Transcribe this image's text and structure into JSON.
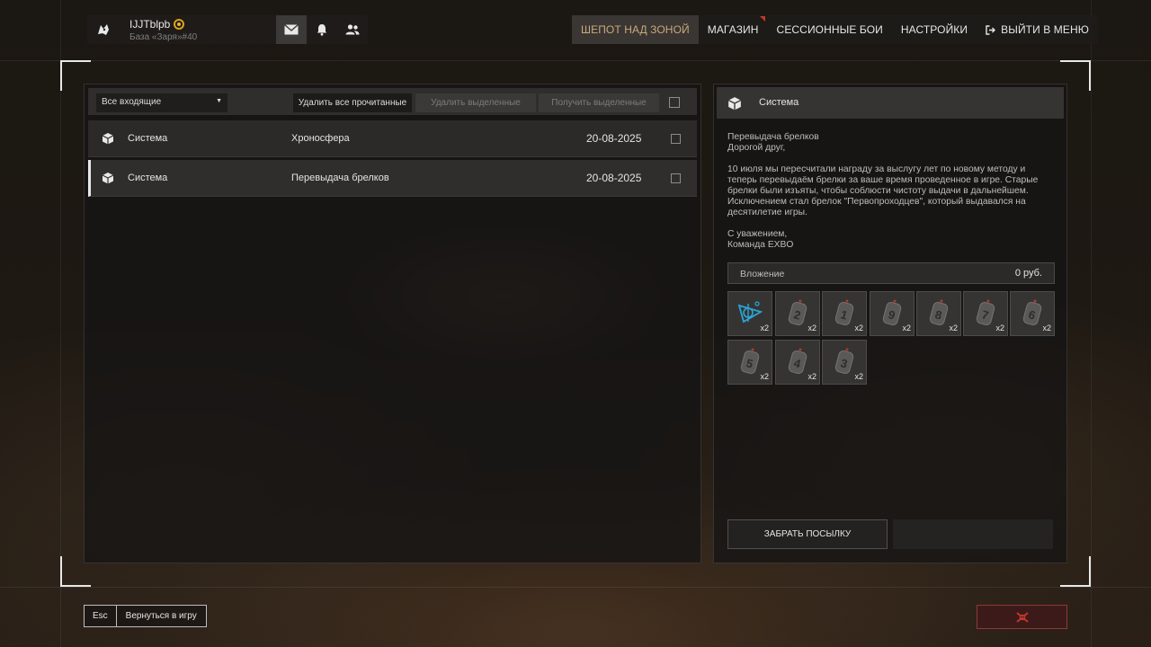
{
  "profile": {
    "name": "IJJTblpb",
    "base": "База «Заря»#40"
  },
  "nav": {
    "items": [
      {
        "label": "ШЕПОТ НАД ЗОНОЙ"
      },
      {
        "label": "МАГАЗИН"
      },
      {
        "label": "СЕССИОННЫЕ БОИ"
      },
      {
        "label": "НАСТРОЙКИ"
      },
      {
        "label": "ВЫЙТИ В МЕНЮ"
      }
    ]
  },
  "inbox": {
    "filter": "Все входящие",
    "delete_read": "Удалить все прочитанные",
    "delete_selected": "Удалить выделенные",
    "receive_selected": "Получить выделенные",
    "messages": [
      {
        "sender": "Система",
        "subject": "Хроносфера",
        "date": "20-08-2025"
      },
      {
        "sender": "Система",
        "subject": "Перевыдача брелков",
        "date": "20-08-2025"
      }
    ]
  },
  "message": {
    "header": "Система",
    "lines": [
      "Перевыдача брелков",
      "Дорогой друг,",
      "",
      "10 июля мы пересчитали награду за выслугу лет по новому методу и",
      "теперь перевыдаём брелки за ваше время проведенное в игре. Старые",
      "брелки были изъяты, чтобы соблюсти чистоту выдачи в дальнейшем.",
      "Исключением стал брелок \"Первопроходцев\", который выдавался на",
      "десятилетие игры.",
      "",
      "С уважением,",
      "Команда EXBO"
    ],
    "attachment_label": "Вложение",
    "attachment_value": "0 руб.",
    "items": [
      {
        "icon": "pathfinder-keychain-icon",
        "qty": "x2"
      },
      {
        "icon": "keychain-2-icon",
        "num": "2",
        "qty": "x2"
      },
      {
        "icon": "keychain-1-icon",
        "num": "1",
        "qty": "x2"
      },
      {
        "icon": "keychain-9-icon",
        "num": "9",
        "qty": "x2"
      },
      {
        "icon": "keychain-8-icon",
        "num": "8",
        "qty": "x2"
      },
      {
        "icon": "keychain-7-icon",
        "num": "7",
        "qty": "x2"
      },
      {
        "icon": "keychain-6-icon",
        "num": "6",
        "qty": "x2"
      },
      {
        "icon": "keychain-5-icon",
        "num": "5",
        "qty": "x2"
      },
      {
        "icon": "keychain-4-icon",
        "num": "4",
        "qty": "x2"
      },
      {
        "icon": "keychain-3-icon",
        "num": "3",
        "qty": "x2"
      }
    ],
    "take_button": "ЗАБРАТЬ ПОСЫЛКУ"
  },
  "bottom": {
    "esc_key": "Esc",
    "back_label": "Вернуться в игру"
  },
  "colors": {
    "accent_gold": "#c9a97c",
    "danger": "#c0392b",
    "pathfinder_blue": "#2aa6d6"
  }
}
